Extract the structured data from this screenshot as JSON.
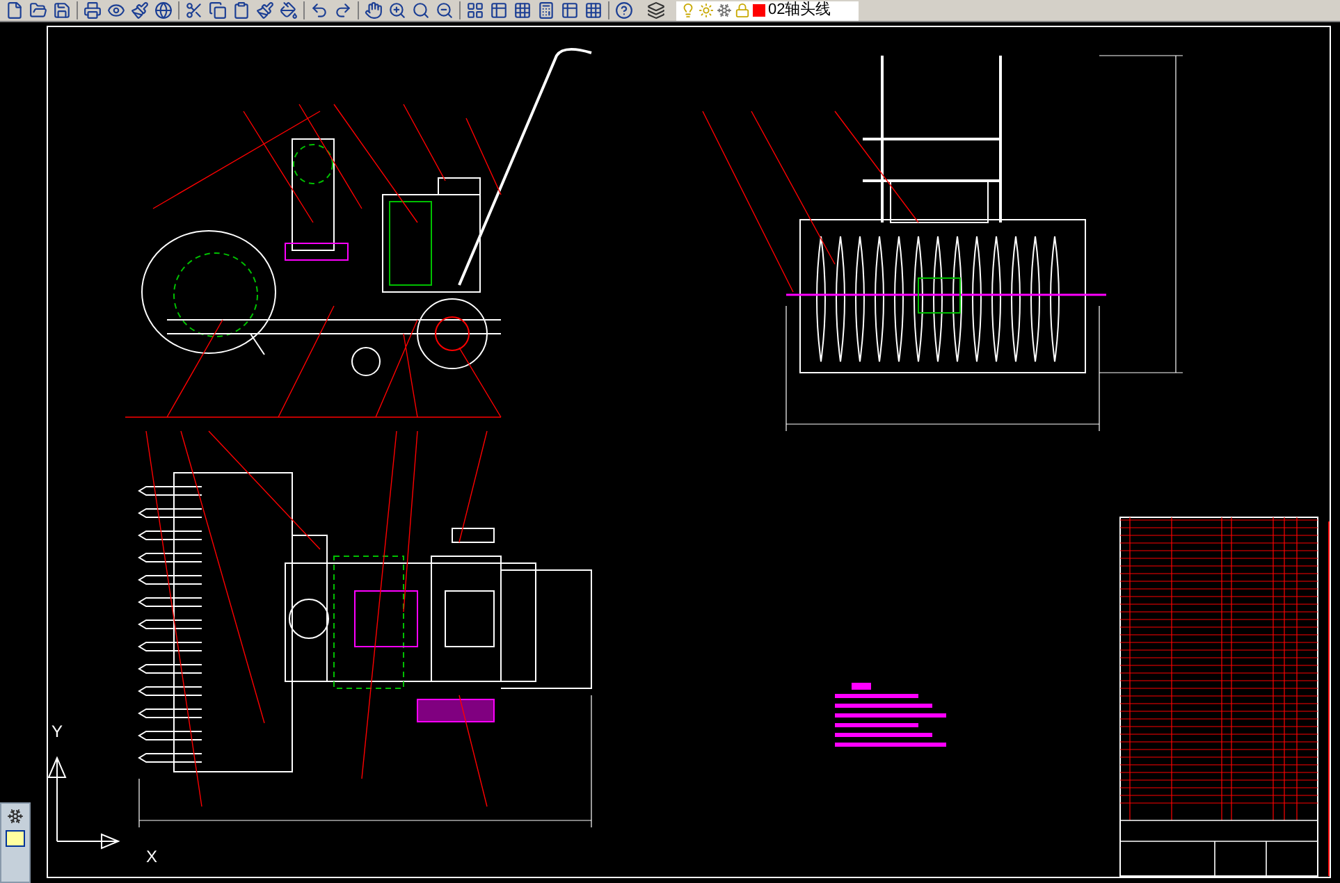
{
  "toolbar": {
    "layer_name": "02轴头线"
  },
  "ucs": {
    "x_label": "X",
    "y_label": "Y"
  }
}
